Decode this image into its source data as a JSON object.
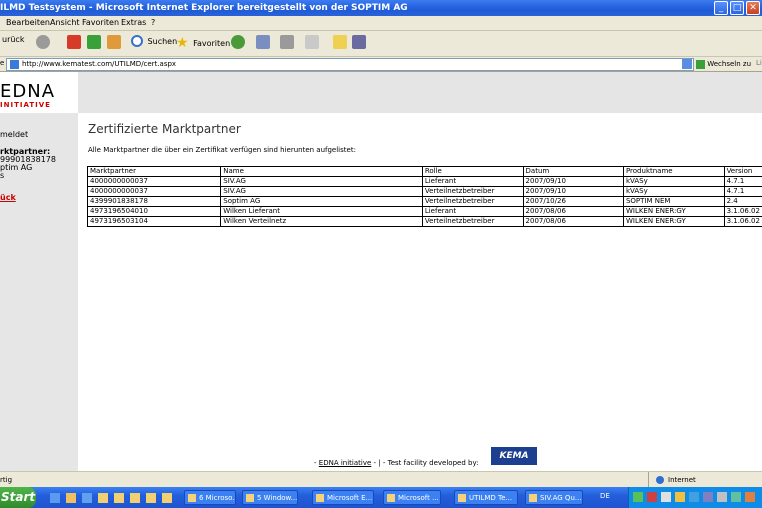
{
  "window": {
    "title": "ILMD Testsystem - Microsoft Internet Explorer bereitgestellt von der SOPTIM AG",
    "minimize_glyph": "_",
    "maximize_glyph": "□",
    "close_glyph": "✕"
  },
  "menu": {
    "items": [
      "Bearbeiten",
      "Ansicht",
      "Favoriten",
      "Extras",
      "?"
    ]
  },
  "toolbar": {
    "back_label": "urück",
    "search_label": "Suchen",
    "favorites_label": "Favoriten"
  },
  "address": {
    "prefix": "e",
    "url": "http://www.kematest.com/UTILMD/cert.aspx",
    "go_label": "Wechseln zu",
    "links_label": "Li"
  },
  "logo": {
    "line1": "EDNA",
    "line2": "INITIATIVE"
  },
  "sidebar": {
    "logout": "meldet",
    "partner_label": "rktpartner:",
    "partner_id": "99901838178",
    "partner_name": "ptim AG",
    "line3": "s",
    "line4": "",
    "back_link": "ück"
  },
  "page": {
    "title": "Zertifizierte Marktpartner",
    "intro": "Alle Marktpartner die über ein Zertifikat verfügen sind hierunten aufgelistet:"
  },
  "table": {
    "headers": [
      "Marktpartner",
      "Name",
      "Rolle",
      "Datum",
      "Produktname",
      "Version"
    ],
    "rows": [
      [
        "4000000000037",
        "SIV.AG",
        "Lieferant",
        "2007/09/10",
        "kVASy",
        "4.7.1"
      ],
      [
        "4000000000037",
        "SIV.AG",
        "Verteilnetzbetreiber",
        "2007/09/10",
        "kVASy",
        "4.7.1"
      ],
      [
        "4399901838178",
        "Soptim AG",
        "Verteilnetzbetreiber",
        "2007/10/26",
        "SOPTIM NEM",
        "2.4"
      ],
      [
        "4973196504010",
        "Wilken Lieferant",
        "Lieferant",
        "2007/08/06",
        "WILKEN ENER:GY",
        "3.1.06.02"
      ],
      [
        "4973196503104",
        "Wilken Verteilnetz",
        "Verteilnetzbetreiber",
        "2007/08/06",
        "WILKEN ENER:GY",
        "3.1.06.02"
      ]
    ]
  },
  "footer": {
    "prefix": "-",
    "edna_link": "EDNA initiative",
    "middle": "- | - Test facility developed by:",
    "kema": "KEMA"
  },
  "status": {
    "left": "rtig",
    "zone": "Internet"
  },
  "taskbar": {
    "start": "Start",
    "tasks": [
      "6 Microso...",
      "5 Window...",
      "Microsoft E...",
      "Microsoft ...",
      "UTILMD Te...",
      "SIV.AG Qu..."
    ],
    "lang": "DE"
  },
  "colors": {
    "xp_blue": "#245edb",
    "start_green": "#2f8a2b",
    "link_red": "#cc0000",
    "kema_blue": "#1d3f8f"
  }
}
